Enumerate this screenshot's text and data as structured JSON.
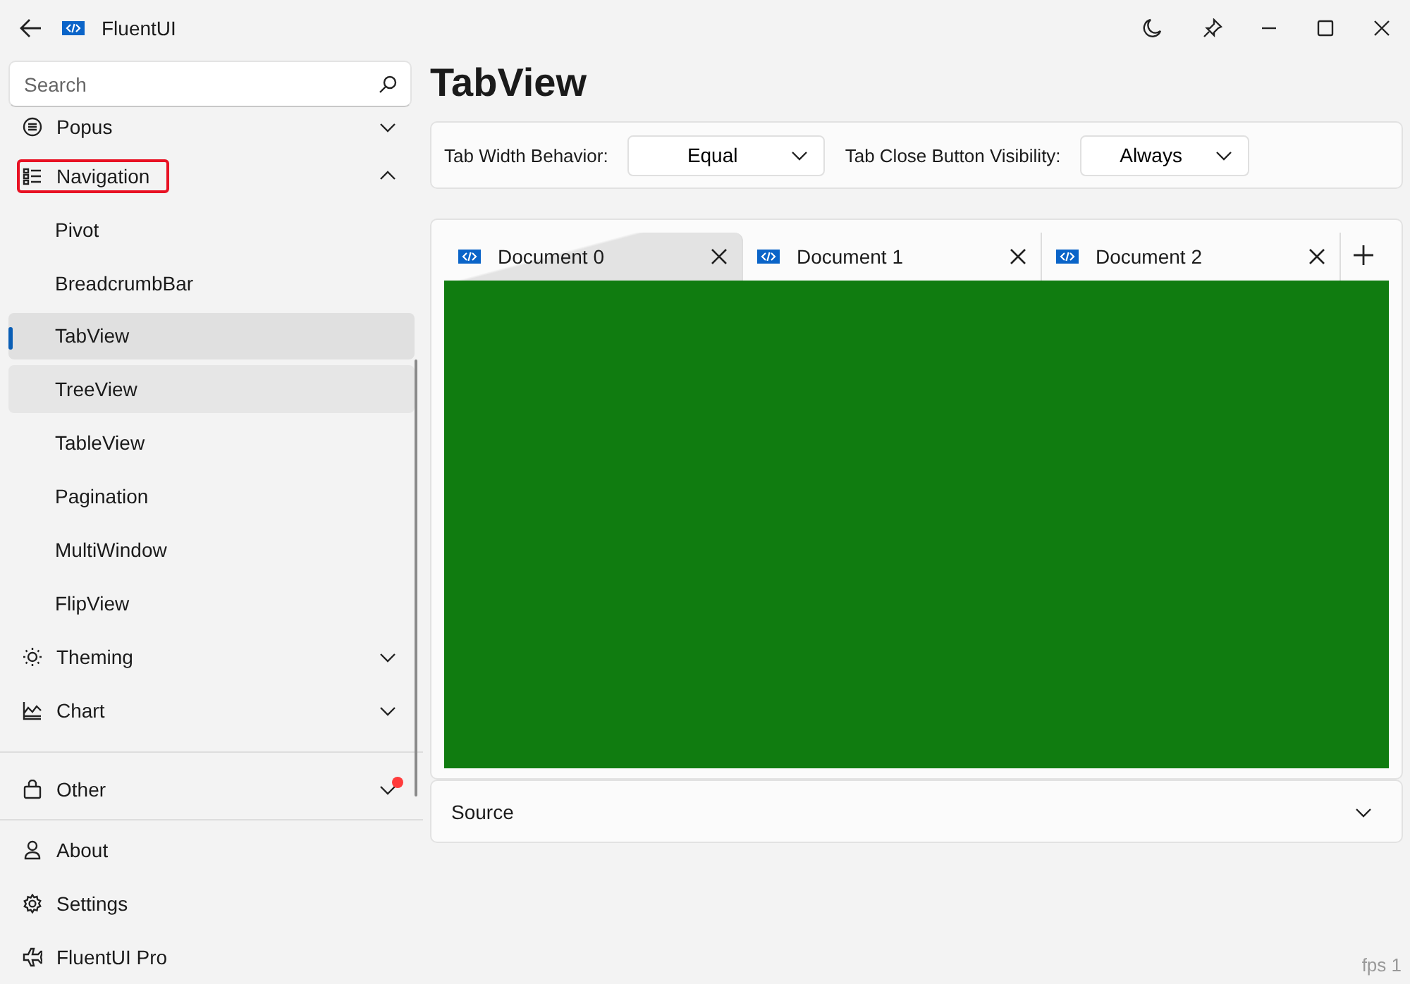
{
  "window": {
    "title": "FluentUI"
  },
  "search": {
    "placeholder": "Search"
  },
  "nav": [
    {
      "kind": "group",
      "label": "Popus",
      "expanded": false,
      "selected": false
    },
    {
      "kind": "group",
      "label": "Navigation",
      "expanded": true,
      "selected": false,
      "focused": true
    },
    {
      "kind": "child",
      "label": "Pivot",
      "selected": false
    },
    {
      "kind": "child",
      "label": "BreadcrumbBar",
      "selected": false
    },
    {
      "kind": "child",
      "label": "TabView",
      "selected": true
    },
    {
      "kind": "child",
      "label": "TreeView",
      "selected": false,
      "hovered": true
    },
    {
      "kind": "child",
      "label": "TableView",
      "selected": false
    },
    {
      "kind": "child",
      "label": "Pagination",
      "selected": false
    },
    {
      "kind": "child",
      "label": "MultiWindow",
      "selected": false
    },
    {
      "kind": "child",
      "label": "FlipView",
      "selected": false
    },
    {
      "kind": "group",
      "label": "Theming",
      "expanded": false,
      "selected": false
    },
    {
      "kind": "group",
      "label": "Chart",
      "expanded": false,
      "selected": false
    },
    {
      "kind": "divider"
    },
    {
      "kind": "group",
      "label": "Other",
      "expanded": false,
      "selected": false,
      "badge": true
    },
    {
      "kind": "divider"
    },
    {
      "kind": "item",
      "label": "About",
      "selected": false
    },
    {
      "kind": "item",
      "label": "Settings",
      "selected": false
    },
    {
      "kind": "item",
      "label": "FluentUI Pro",
      "selected": false
    }
  ],
  "page": {
    "title": "TabView",
    "options": [
      {
        "label": "Tab Width Behavior:",
        "value": "Equal"
      },
      {
        "label": "Tab Close Button Visibility:",
        "value": "Always"
      }
    ],
    "tabs": [
      {
        "label": "Document 0",
        "selected": true
      },
      {
        "label": "Document 1",
        "selected": false
      },
      {
        "label": "Document 2",
        "selected": false
      }
    ],
    "source": {
      "label": "Source",
      "expanded": false
    }
  },
  "fps": "fps 1"
}
